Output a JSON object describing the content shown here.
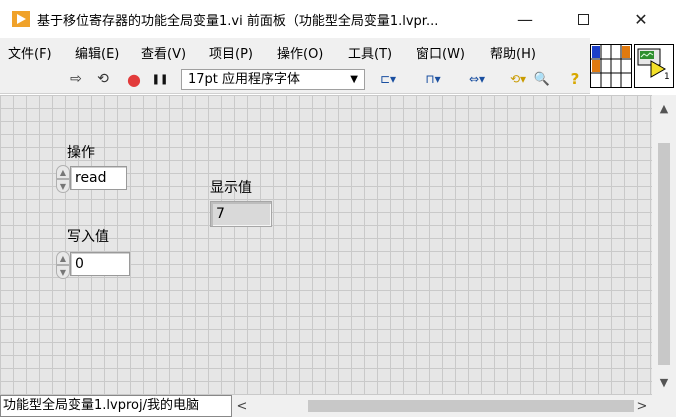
{
  "window": {
    "title": "基于移位寄存器的功能全局变量1.vi 前面板（功能型全局变量1.lvpr...",
    "minimize_glyph": "—",
    "close_glyph": "✕"
  },
  "menu": {
    "items": [
      {
        "label": "文件(F)"
      },
      {
        "label": "编辑(E)"
      },
      {
        "label": "查看(V)"
      },
      {
        "label": "项目(P)"
      },
      {
        "label": "操作(O)"
      },
      {
        "label": "工具(T)"
      },
      {
        "label": "窗口(W)"
      },
      {
        "label": "帮助(H)"
      }
    ]
  },
  "toolbar": {
    "run_glyph": "⇨",
    "run_cont_glyph": "⟲",
    "abort_glyph": "●",
    "pause_glyph": "❚❚",
    "font": "17pt 应用程序字体",
    "dropdown_glyph": "▼",
    "align_glyph": "⊏▾",
    "distribute_glyph": "⊓▾",
    "resize_glyph": "⇔▾",
    "reorder_glyph": "⟲▾",
    "search_glyph": "🔍",
    "help_glyph": "?"
  },
  "icon_pane": {
    "number": "1"
  },
  "panel": {
    "operation_label": "操作",
    "operation_value": "read",
    "display_label": "显示值",
    "display_value": "7",
    "write_label": "写入值",
    "write_value": "0"
  },
  "statusbar": {
    "path": "功能型全局变量1.lvproj/我的电脑"
  },
  "scroll": {
    "up": "▲",
    "down": "▼",
    "left": "<",
    "right": ">"
  },
  "colors": {
    "panel_bg": "#e6e6e6",
    "grid_line": "#c9c9c9",
    "labview_orange": "#f0a22a",
    "abort_red": "#e23b3b"
  }
}
